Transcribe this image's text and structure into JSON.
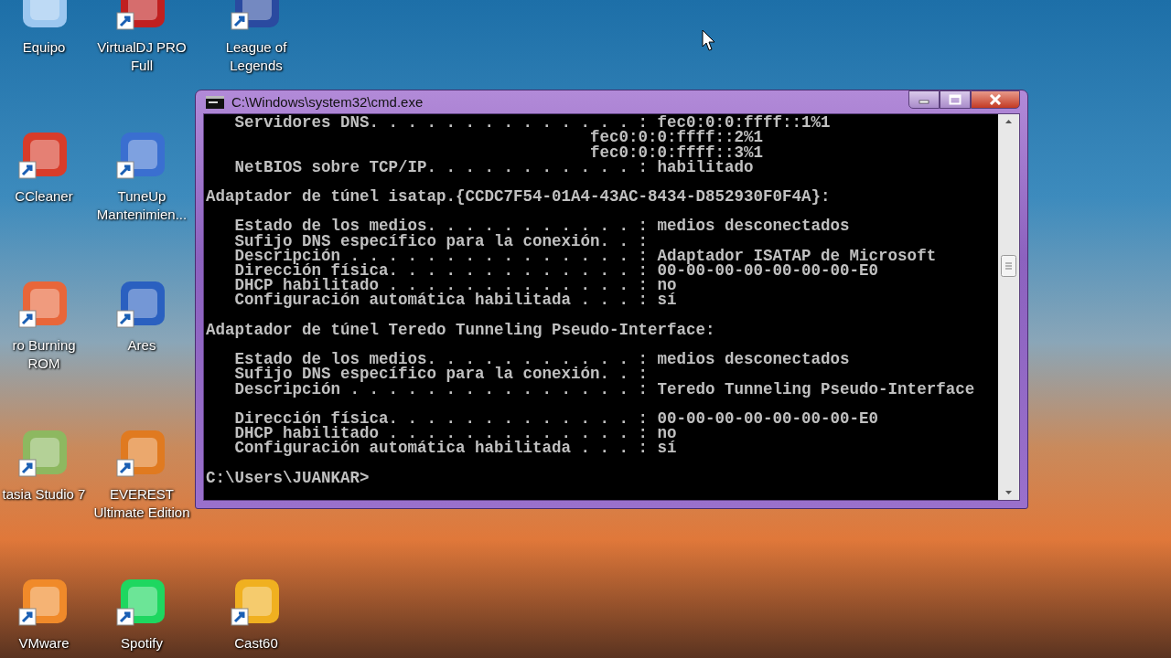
{
  "desktop_columns": [
    [
      {
        "label": "Equipo",
        "shortcut": false
      },
      {
        "label": "CCleaner",
        "shortcut": true
      },
      {
        "label": "ro Burning ROM",
        "shortcut": true
      },
      {
        "label": "tasia Studio 7",
        "shortcut": true
      },
      {
        "label": "VMware",
        "shortcut": true
      }
    ],
    [
      {
        "label": "VirtualDJ PRO Full",
        "shortcut": true
      },
      {
        "label": "TuneUp Mantenimien...",
        "shortcut": true
      },
      {
        "label": "Ares",
        "shortcut": true
      },
      {
        "label": "EVEREST Ultimate Edition",
        "shortcut": true
      },
      {
        "label": "Spotify",
        "shortcut": true
      }
    ],
    [
      {
        "label": "League of Legends",
        "shortcut": true
      },
      {
        "label": "Cast60",
        "shortcut": true
      }
    ]
  ],
  "window": {
    "title": "C:\\Windows\\system32\\cmd.exe",
    "console_blocks": [
      [
        "   Servidores DNS. . . . . . . . . . . . . . : fec0:0:0:ffff::1%1",
        "                                        fec0:0:0:ffff::2%1",
        "                                        fec0:0:0:ffff::3%1",
        "   NetBIOS sobre TCP/IP. . . . . . . . . . . : habilitado"
      ],
      [
        "Adaptador de túnel isatap.{CCDC7F54-01A4-43AC-8434-D852930F0F4A}:"
      ],
      [
        "   Estado de los medios. . . . . . . . . . . : medios desconectados",
        "   Sufijo DNS específico para la conexión. . :",
        "   Descripción . . . . . . . . . . . . . . . : Adaptador ISATAP de Microsoft",
        "   Dirección física. . . . . . . . . . . . . : 00-00-00-00-00-00-00-E0",
        "   DHCP habilitado . . . . . . . . . . . . . : no",
        "   Configuración automática habilitada . . . : sí"
      ],
      [
        "Adaptador de túnel Teredo Tunneling Pseudo-Interface:"
      ],
      [
        "   Estado de los medios. . . . . . . . . . . : medios desconectados",
        "   Sufijo DNS específico para la conexión. . :",
        "   Descripción . . . . . . . . . . . . . . . : Teredo Tunneling Pseudo-Interface"
      ],
      [
        "   Dirección física. . . . . . . . . . . . . : 00-00-00-00-00-00-00-E0",
        "   DHCP habilitado . . . . . . . . . . . . . : no",
        "   Configuración automática habilitada . . . : sí"
      ],
      [
        "C:\\Users\\JUANKAR>"
      ]
    ]
  }
}
